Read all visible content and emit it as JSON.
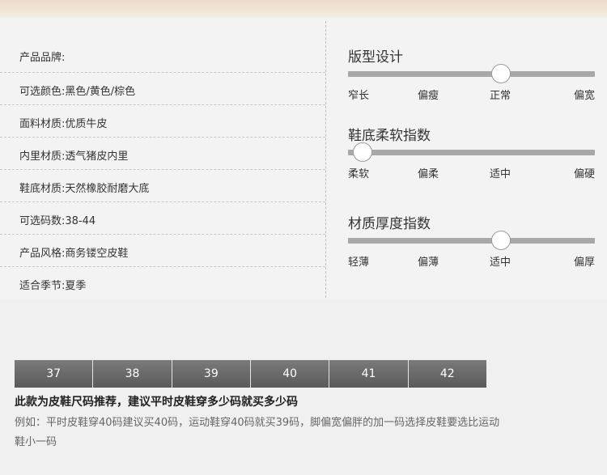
{
  "specs": [
    {
      "label": "产品品牌:",
      "value": ""
    },
    {
      "label": "可选颜色:",
      "value": "黑色/黄色/棕色"
    },
    {
      "label": "面料材质:",
      "value": "优质牛皮"
    },
    {
      "label": "内里材质:",
      "value": "透气猪皮内里"
    },
    {
      "label": "鞋底材质:",
      "value": "天然橡胶耐磨大底"
    },
    {
      "label": "可选码数:",
      "value": "38-44"
    },
    {
      "label": "产品风格:",
      "value": "商务镂空皮鞋"
    },
    {
      "label": "适合季节:",
      "value": "夏季"
    }
  ],
  "scales": [
    {
      "title": "版型设计",
      "labels": [
        "窄长",
        "偏瘦",
        "正常",
        "偏宽"
      ],
      "selected_index": 2,
      "value_fraction": 0.62
    },
    {
      "title": "鞋底柔软指数",
      "labels": [
        "柔软",
        "偏柔",
        "适中",
        "偏硬"
      ],
      "selected_index": 0,
      "value_fraction": 0.06
    },
    {
      "title": "材质厚度指数",
      "labels": [
        "轻薄",
        "偏薄",
        "适中",
        "偏厚"
      ],
      "selected_index": 2,
      "value_fraction": 0.62
    }
  ],
  "sizes": [
    "37",
    "38",
    "39",
    "40",
    "41",
    "42"
  ],
  "note": {
    "title": "此款为皮鞋尺码推荐，建议平时皮鞋穿多少码就买多少码",
    "body": "例如：平时皮鞋穿40码建议买40码，运动鞋穿40码就买39码，脚偏宽偏胖的加一码选择皮鞋要选比运动鞋小一码"
  },
  "colors": {
    "track": "#a8a8a8",
    "size_cell": "#666666",
    "background": "#f0f0f0"
  }
}
